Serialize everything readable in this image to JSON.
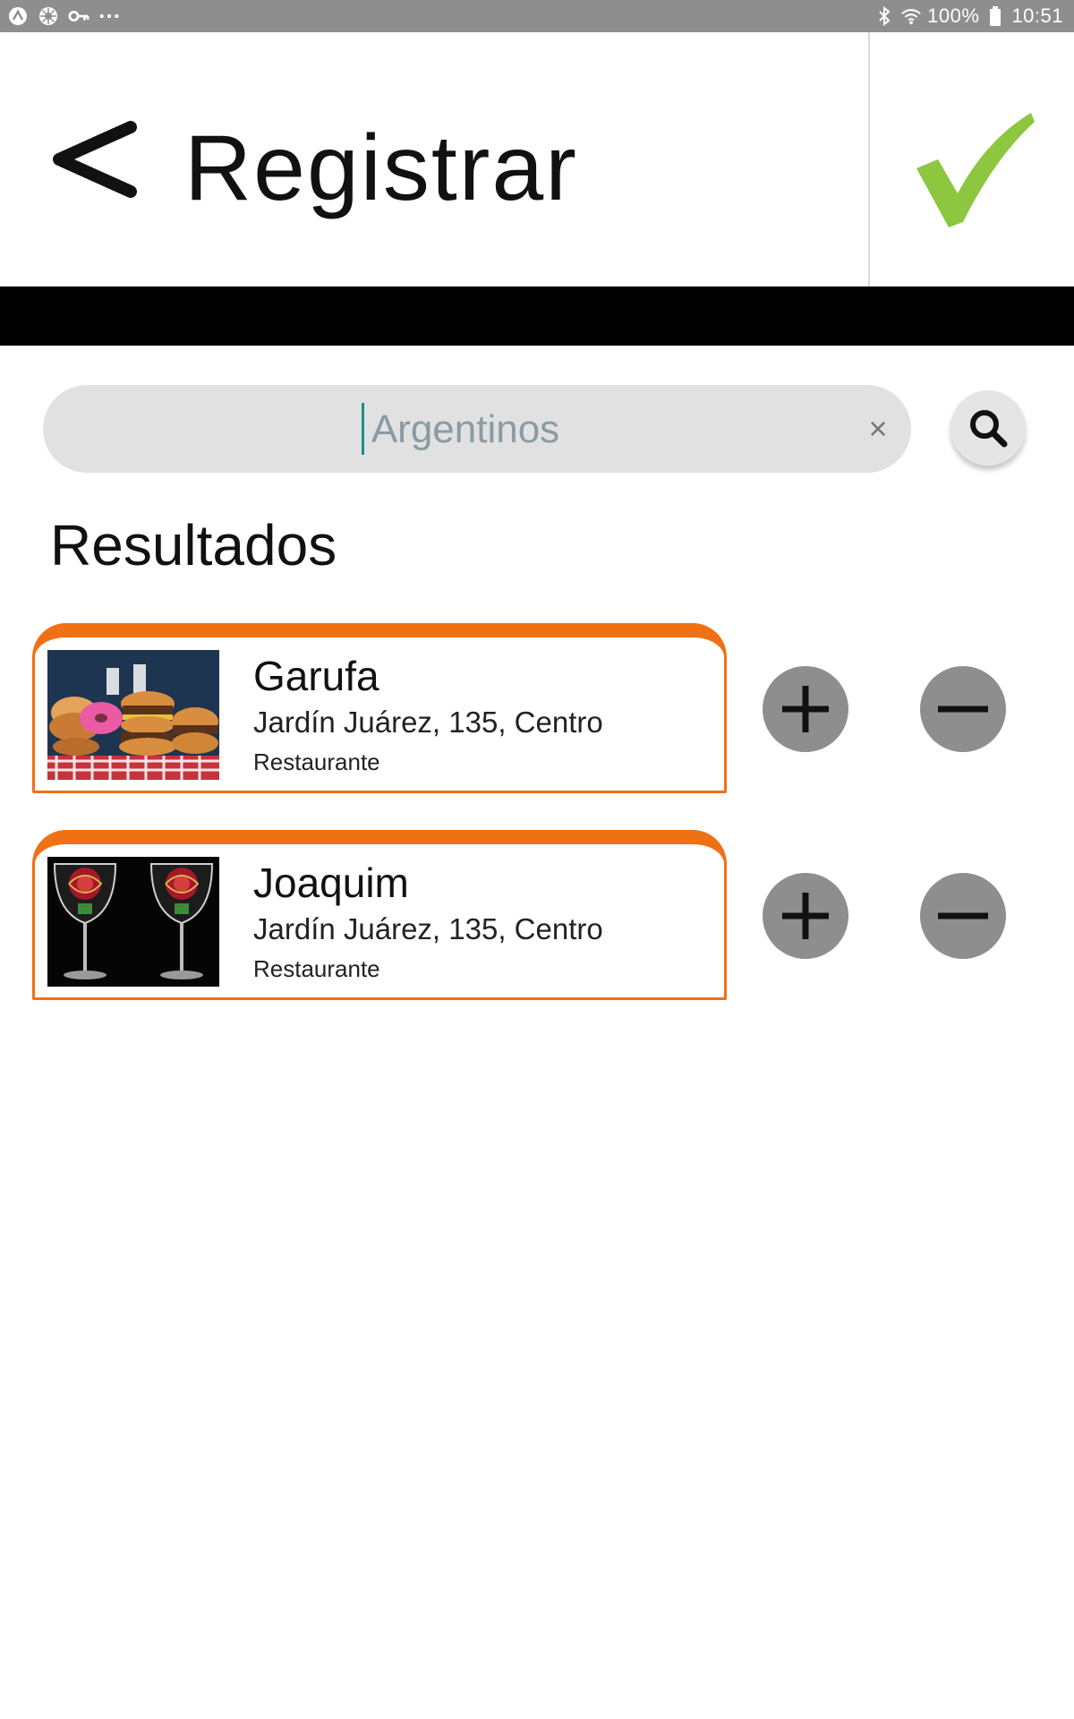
{
  "status_bar": {
    "left_icons": [
      "app-a-icon",
      "settings-wheel-icon",
      "key-icon",
      "more-dots-icon"
    ],
    "battery": "100%",
    "time": "10:51",
    "right_icons": [
      "bluetooth-icon",
      "wifi-icon",
      "battery-icon"
    ]
  },
  "header": {
    "title": "Registrar",
    "back_icon": "chevron-left-icon",
    "confirm_icon": "checkmark-icon",
    "confirm_color": "#8dc63f"
  },
  "search": {
    "placeholder": "Argentinos",
    "value": "",
    "clear_label": "×",
    "search_icon": "search-icon"
  },
  "results": {
    "title": "Resultados",
    "items": [
      {
        "name": "Garufa",
        "address": "Jardín Juárez, 135, Centro",
        "type": "Restaurante",
        "image": "fast-food-photo"
      },
      {
        "name": "Joaquim",
        "address": "Jardín Juárez, 135, Centro",
        "type": "Restaurante",
        "image": "wine-glasses-photo"
      }
    ]
  },
  "colors": {
    "accent": "#f07014",
    "confirm": "#8dc63f",
    "button_gray": "#8e8e8e",
    "status_bar": "#8e8e8e"
  }
}
